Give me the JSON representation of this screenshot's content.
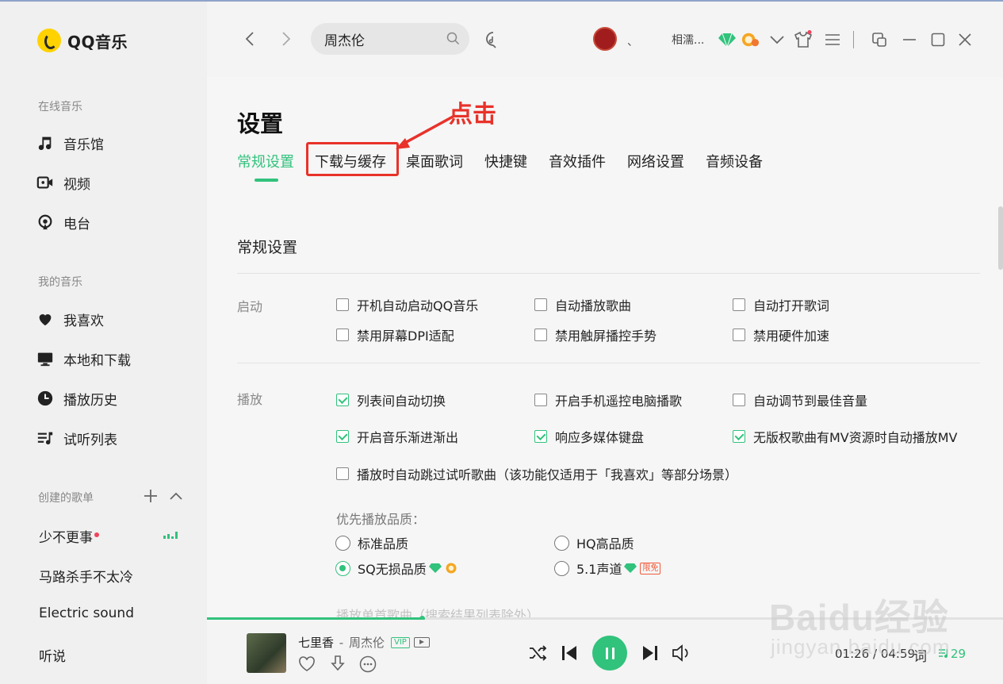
{
  "app": {
    "name": "QQ音乐"
  },
  "sidebar": {
    "online_title": "在线音乐",
    "online_items": [
      {
        "label": "音乐馆",
        "icon": "music-note-icon"
      },
      {
        "label": "视频",
        "icon": "video-icon"
      },
      {
        "label": "电台",
        "icon": "radio-icon"
      }
    ],
    "my_title": "我的音乐",
    "my_items": [
      {
        "label": "我喜欢",
        "icon": "heart-icon"
      },
      {
        "label": "本地和下载",
        "icon": "monitor-icon"
      },
      {
        "label": "播放历史",
        "icon": "history-icon"
      },
      {
        "label": "试听列表",
        "icon": "playlist-icon"
      }
    ],
    "created_title": "创建的歌单",
    "playlists": [
      "少不更事",
      "马路杀手不太冷",
      "Electric sound",
      "听说"
    ]
  },
  "topbar": {
    "search_value": "周杰伦",
    "comma": "、",
    "username": "相濡...",
    "accent_color": "#31c27c"
  },
  "settings": {
    "title": "设置",
    "annotation": "点击",
    "tabs": [
      "常规设置",
      "下载与缓存",
      "桌面歌词",
      "快捷键",
      "音效插件",
      "网络设置",
      "音频设备"
    ],
    "section_title": "常规设置",
    "startup": {
      "label": "启动",
      "options": [
        {
          "label": "开机自动启动QQ音乐",
          "checked": false
        },
        {
          "label": "自动播放歌曲",
          "checked": false
        },
        {
          "label": "自动打开歌词",
          "checked": false
        },
        {
          "label": "禁用屏幕DPI适配",
          "checked": false
        },
        {
          "label": "禁用触屏播控手势",
          "checked": false
        },
        {
          "label": "禁用硬件加速",
          "checked": false
        }
      ]
    },
    "playback": {
      "label": "播放",
      "options": [
        {
          "label": "列表间自动切换",
          "checked": true
        },
        {
          "label": "开启手机遥控电脑播歌",
          "checked": false
        },
        {
          "label": "自动调节到最佳音量",
          "checked": false
        },
        {
          "label": "开启音乐渐进渐出",
          "checked": true
        },
        {
          "label": "响应多媒体键盘",
          "checked": true
        },
        {
          "label": "无版权歌曲有MV资源时自动播放MV",
          "checked": true
        },
        {
          "label": "播放时自动跳过试听歌曲（该功能仅适用于「我喜欢」等部分场景）",
          "checked": false
        }
      ],
      "quality_title": "优先播放品质：",
      "qualities": [
        {
          "label": "标准品质",
          "selected": false
        },
        {
          "label": "HQ高品质",
          "selected": false
        },
        {
          "label": "SQ无损品质",
          "selected": true
        },
        {
          "label": "5.1声道",
          "selected": false,
          "badge": "限免"
        }
      ],
      "cut_off_text": "播放单首歌曲（搜索结果列表除外）"
    }
  },
  "player": {
    "song": "七里香",
    "artist": "周杰伦",
    "vip": "VIP",
    "time": "01:26 / 04:59",
    "lyric_label": "词",
    "queue_count": "29",
    "progress": 0.27
  },
  "watermark": {
    "big": "Baidu经验",
    "small": "jingyan.baidu.com"
  }
}
